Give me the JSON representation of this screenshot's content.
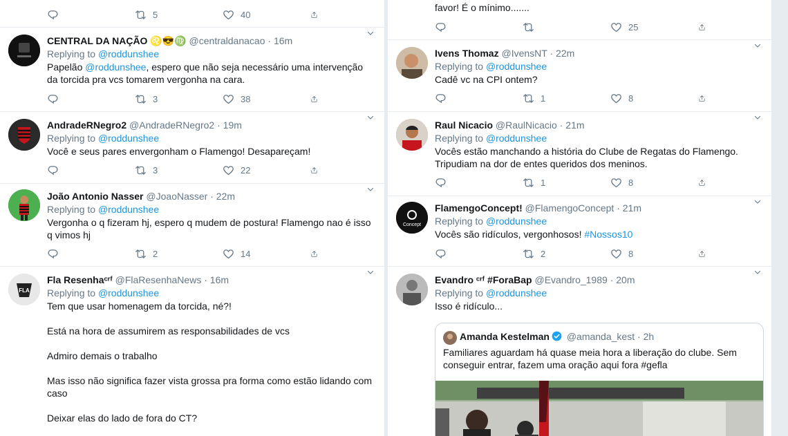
{
  "left_column": {
    "partial_top": {
      "retweets": "5",
      "likes": "40"
    },
    "tweets": [
      {
        "name": "CENTRAL DA NAÇÃO ♌😎♍",
        "handle": "@centraldanacao",
        "time": "16m",
        "replying_label": "Replying to",
        "replying_to": "@roddunshee",
        "text_pre": "Papelão ",
        "text_mention": "@roddunshee",
        "text_post": ", espero que não seja necessário uma intervenção da torcida pra vcs tomarem vergonha na cara.",
        "replies": "",
        "retweets": "3",
        "likes": "38"
      },
      {
        "name": "AndradeRNegro2",
        "handle": "@AndradeRNegro2",
        "time": "19m",
        "replying_label": "Replying to",
        "replying_to": "@roddunshee",
        "text": "Você e seus pares envergonham o Flamengo! Desapareçam!",
        "retweets": "3",
        "likes": "22"
      },
      {
        "name": "João Antonio Nasser",
        "handle": "@JoaoNasser",
        "time": "22m",
        "replying_label": "Replying to",
        "replying_to": "@roddunshee",
        "text": "Vergonha o q fizeram hj, espero q mudem de postura! Flamengo nao é isso q vimos hj",
        "retweets": "2",
        "likes": "14"
      },
      {
        "name": "Fla Resenhaᶜʳᶠ",
        "handle": "@FlaResenhaNews",
        "time": "16m",
        "replying_label": "Replying to",
        "replying_to": "@roddunshee",
        "text": "Tem que usar homenagem da torcida, né?!\n\nEstá na hora de assumirem as responsabilidades de vcs\n\nAdmiro demais o trabalho\n\nMas isso não significa fazer vista grossa pra forma como estão lidando com caso\n\nDeixar elas do lado de fora do CT?"
      }
    ]
  },
  "right_column": {
    "partial_top": {
      "text": "favor! É o mínimo.......",
      "likes": "25"
    },
    "tweets": [
      {
        "name": "Ivens Thomaz",
        "handle": "@IvensNT",
        "time": "22m",
        "replying_label": "Replying to",
        "replying_to": "@roddunshee",
        "text": "Cadê vc na CPI ontem?",
        "retweets": "1",
        "likes": "8"
      },
      {
        "name": "Raul Nicacio",
        "handle": "@RaulNicacio",
        "time": "21m",
        "replying_label": "Replying to",
        "replying_to": "@roddunshee",
        "text": "Vocês estão manchando a história do Clube de Regatas do Flamengo. Tripudiam na dor de entes queridos dos meninos.",
        "retweets": "1",
        "likes": "8"
      },
      {
        "name": "FlamengoConcept!",
        "handle": "@FlamengoConcept",
        "time": "21m",
        "replying_label": "Replying to",
        "replying_to": "@roddunshee",
        "text_pre": "Vocês são ridículos, vergonhosos! ",
        "text_hashtag": "#Nossos10",
        "retweets": "2",
        "likes": "8"
      },
      {
        "name": "Evandro ᶜʳᶠ #ForaBap",
        "handle": "@Evandro_1989",
        "time": "20m",
        "replying_label": "Replying to",
        "replying_to": "@roddunshee",
        "text": "Isso é ridículo...",
        "quote": {
          "name": "Amanda Kestelman",
          "handle": "@amanda_kest",
          "time": "2h",
          "text_pre": "Familiares aguardam há quase meia hora a liberação do clube. Sem conseguir entrar, fazem uma oração aqui fora ",
          "hashtag": "#gefla"
        }
      }
    ]
  },
  "separator": "·",
  "colors": {
    "link": "#1b95e0",
    "muted": "#657786",
    "border": "#e6ecf0",
    "verified": "#1da1f2"
  }
}
